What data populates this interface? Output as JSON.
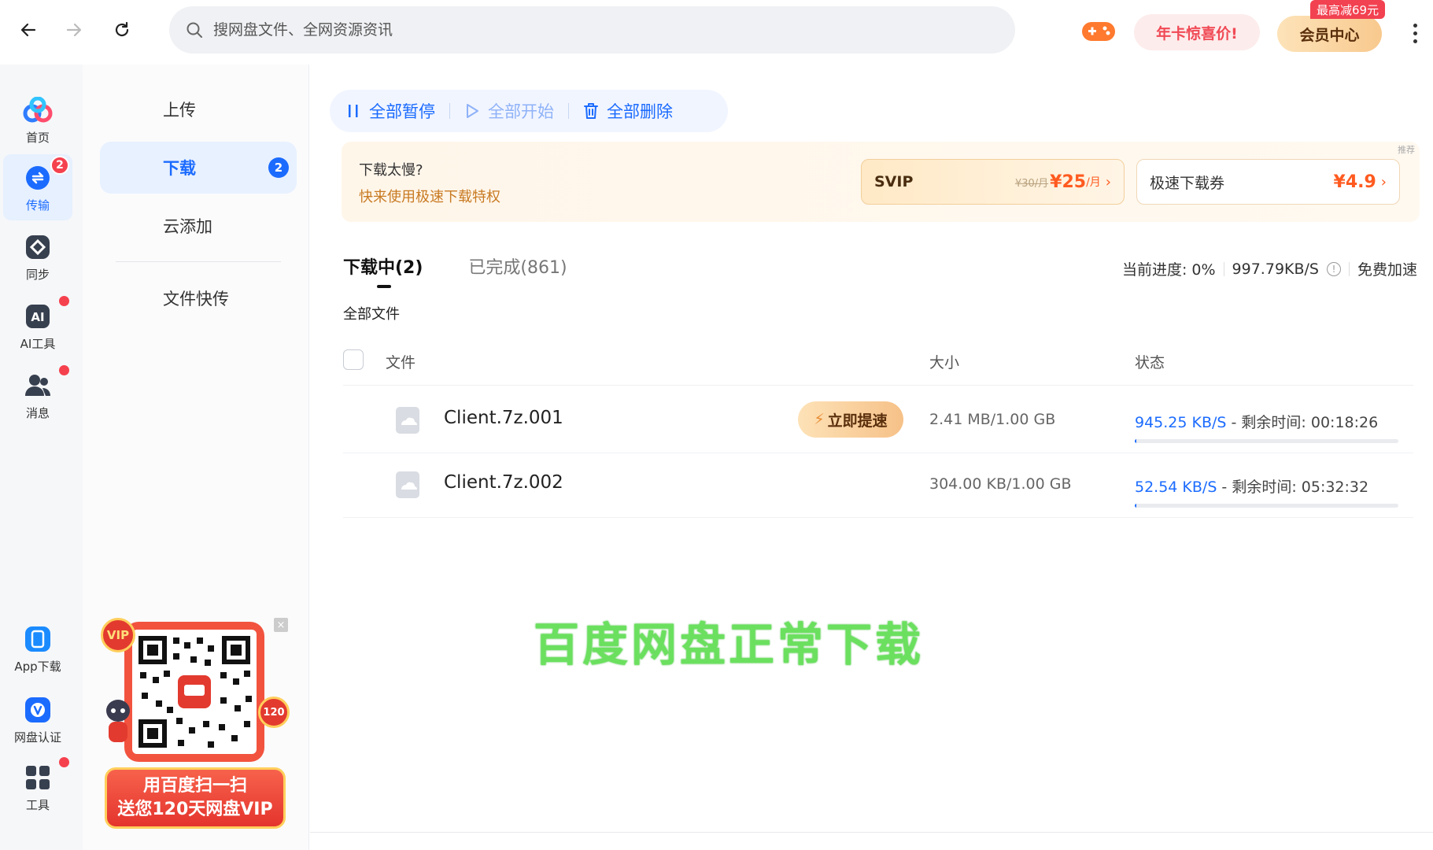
{
  "topbar": {
    "search_placeholder": "搜网盘文件、全网资源资讯",
    "promo_label": "年卡惊喜价!",
    "vip_center_label": "会员中心",
    "vip_tag": "最高减69元"
  },
  "rail": {
    "items": [
      {
        "label": "首页",
        "icon": "cloud-logo-icon"
      },
      {
        "label": "传输",
        "icon": "transfer-icon",
        "badge": "2"
      },
      {
        "label": "同步",
        "icon": "sync-icon"
      },
      {
        "label": "AI工具",
        "icon": "ai-icon"
      },
      {
        "label": "消息",
        "icon": "contacts-icon"
      },
      {
        "label": "App下载",
        "icon": "phone-icon"
      },
      {
        "label": "网盘认证",
        "icon": "verify-icon"
      },
      {
        "label": "工具",
        "icon": "grid-icon"
      }
    ]
  },
  "subnav": {
    "items": [
      {
        "label": "上传"
      },
      {
        "label": "下载",
        "badge": "2"
      },
      {
        "label": "云添加"
      },
      {
        "label": "文件快传"
      }
    ]
  },
  "qr_promo": {
    "vip_label": "VIP",
    "days_label": "120",
    "line1": "用百度扫一扫",
    "line2": "送您120天网盘VIP",
    "close": "×"
  },
  "actions": {
    "pause_all": "全部暂停",
    "start_all": "全部开始",
    "delete_all": "全部删除"
  },
  "speed_banner": {
    "title": "下载太慢?",
    "subtitle": "快来使用极速下载特权",
    "tag": "推荐",
    "svip_name": "SVIP",
    "svip_old_price": "¥30/月",
    "svip_price": "¥25",
    "svip_unit": "/月",
    "coupon_name": "极速下载券",
    "coupon_price": "¥4.9"
  },
  "tabs": {
    "downloading": "下载中(2)",
    "completed": "已完成(861)"
  },
  "progress": {
    "label": "当前进度: 0%",
    "speed": "997.79KB/S",
    "free_boost": "免费加速"
  },
  "breadcrumb": "全部文件",
  "table": {
    "headers": {
      "file": "文件",
      "size": "大小",
      "status": "状态"
    },
    "rows": [
      {
        "name": "Client.7z.001",
        "size": "2.41 MB/1.00 GB",
        "speed": "945.25 KB/S",
        "remaining": " - 剩余时间: 00:18:26",
        "boost": "立即提速",
        "progress": 0.0024
      },
      {
        "name": "Client.7z.002",
        "size": "304.00 KB/1.00 GB",
        "speed": "52.54 KB/S",
        "remaining": " - 剩余时间: 05:32:32",
        "progress": 0.0003
      }
    ]
  },
  "overlay_caption": "百度网盘正常下载",
  "colors": {
    "accent": "#1b6bff",
    "badge": "#f5414e",
    "overlay_green": "#6be05f",
    "price_orange": "#ff5a1f"
  }
}
